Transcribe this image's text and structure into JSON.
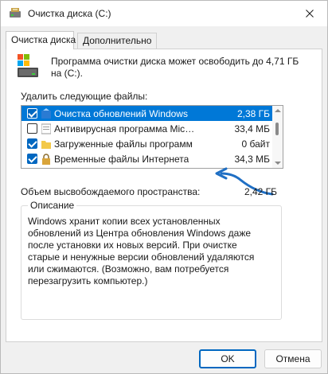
{
  "window": {
    "title": "Очистка диска  (C:)"
  },
  "tabs": [
    {
      "label": "Очистка диска",
      "active": true
    },
    {
      "label": "Дополнительно",
      "active": false
    }
  ],
  "info": {
    "text": "Программа очистки диска может освободить до 4,71 ГБ на  (C:).",
    "icon": "drive-icon"
  },
  "files": {
    "label": "Удалить следующие файлы:",
    "items": [
      {
        "name": "Очистка обновлений Windows",
        "size": "2,38 ГБ",
        "checked": true,
        "selected": true,
        "icon": "update-icon"
      },
      {
        "name": "Антивирусная программа Microsoft Defender",
        "size": "33,4 МБ",
        "checked": false,
        "selected": false,
        "icon": "shield-icon"
      },
      {
        "name": "Загруженные файлы программ",
        "size": "0 байт",
        "checked": true,
        "selected": false,
        "icon": "folder-icon"
      },
      {
        "name": "Временные файлы Интернета",
        "size": "34,3 МБ",
        "checked": true,
        "selected": false,
        "icon": "lock-icon"
      }
    ]
  },
  "freed": {
    "label": "Объем высвобождаемого пространства:",
    "value": "2,42 ГБ"
  },
  "description": {
    "title": "Описание",
    "text": "Windows хранит копии всех установленных обновлений из Центра обновления Windows даже после установки их новых версий. При очистке старые и ненужные версии обновлений удаляются или сжимаются. (Возможно, вам потребуется перезагрузить компьютер.)"
  },
  "buttons": {
    "ok": "OK",
    "cancel": "Отмена"
  },
  "colors": {
    "accent": "#0067c0",
    "selection": "#0078d7",
    "annotation_arrow": "#1f6fc4"
  }
}
